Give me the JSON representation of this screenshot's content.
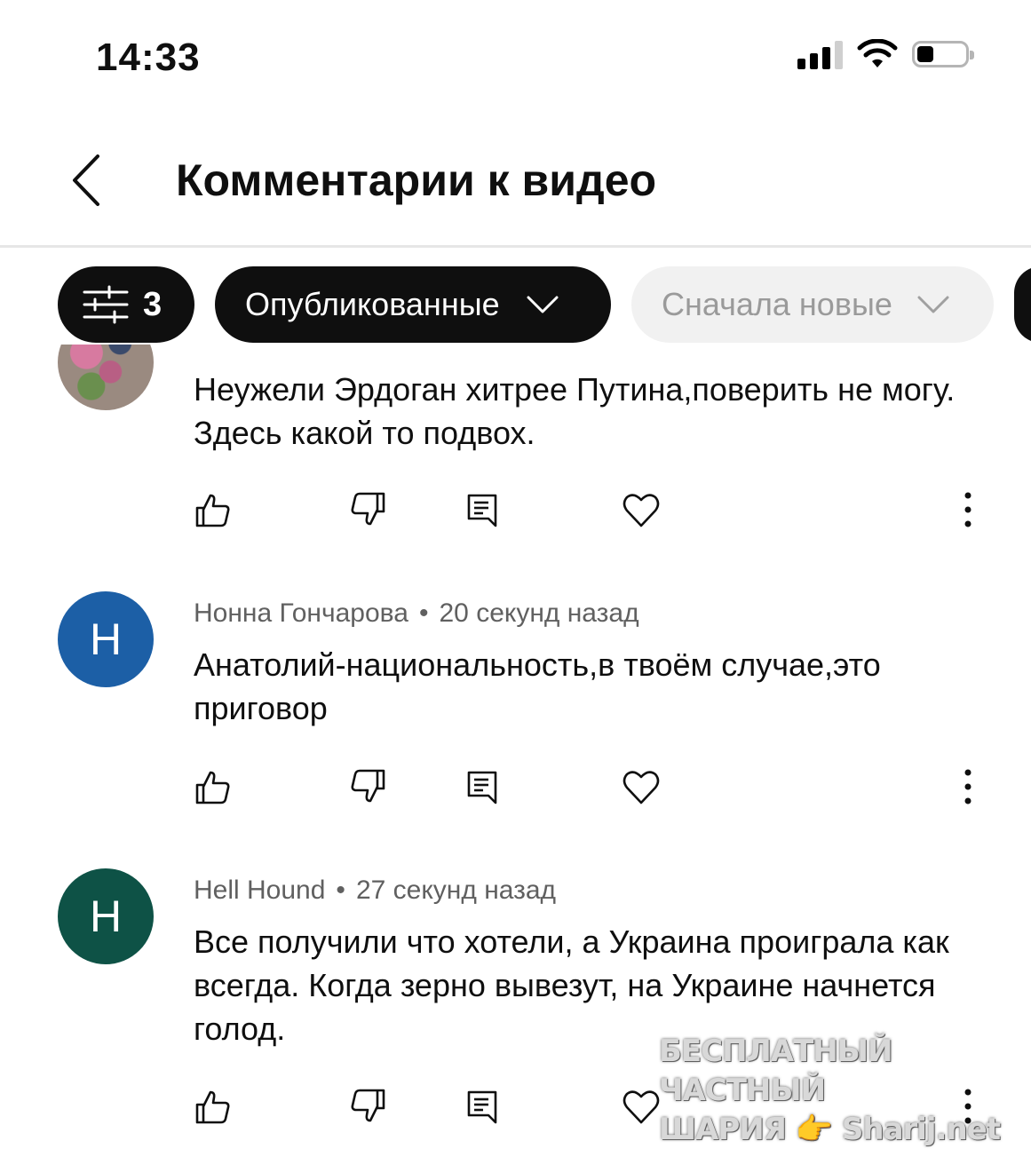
{
  "status_bar": {
    "time": "14:33",
    "battery_level": 0.35
  },
  "header": {
    "title": "Комментарии к видео"
  },
  "filters": {
    "filter_count": "3",
    "published_label": "Опубликованные",
    "sort_label": "Сначала новые"
  },
  "comments": [
    {
      "author": "",
      "time": "",
      "text": "Неужели Эрдоган хитрее Путина,поверить не могу. Здесь какой то подвох."
    },
    {
      "author": "Нонна Гончарова",
      "time": "20 секунд назад",
      "avatar_letter": "Н",
      "avatar_color": "#1c5fa6",
      "text": "Анатолий-национальность,в твоём случае,это приговор"
    },
    {
      "author": "Hell Hound",
      "time": "27 секунд назад",
      "avatar_letter": "H",
      "avatar_color": "#0e5246",
      "text": "Все получили что хотели, а Украина проиграла как всегда. Когда зерно вывезут, на Украине начнется голод."
    }
  ],
  "watermark": {
    "line1": "БЕСПЛАТНЫЙ ЧАСТНЫЙ",
    "line2": "ШАРИЯ 👉 Sharij.net"
  }
}
